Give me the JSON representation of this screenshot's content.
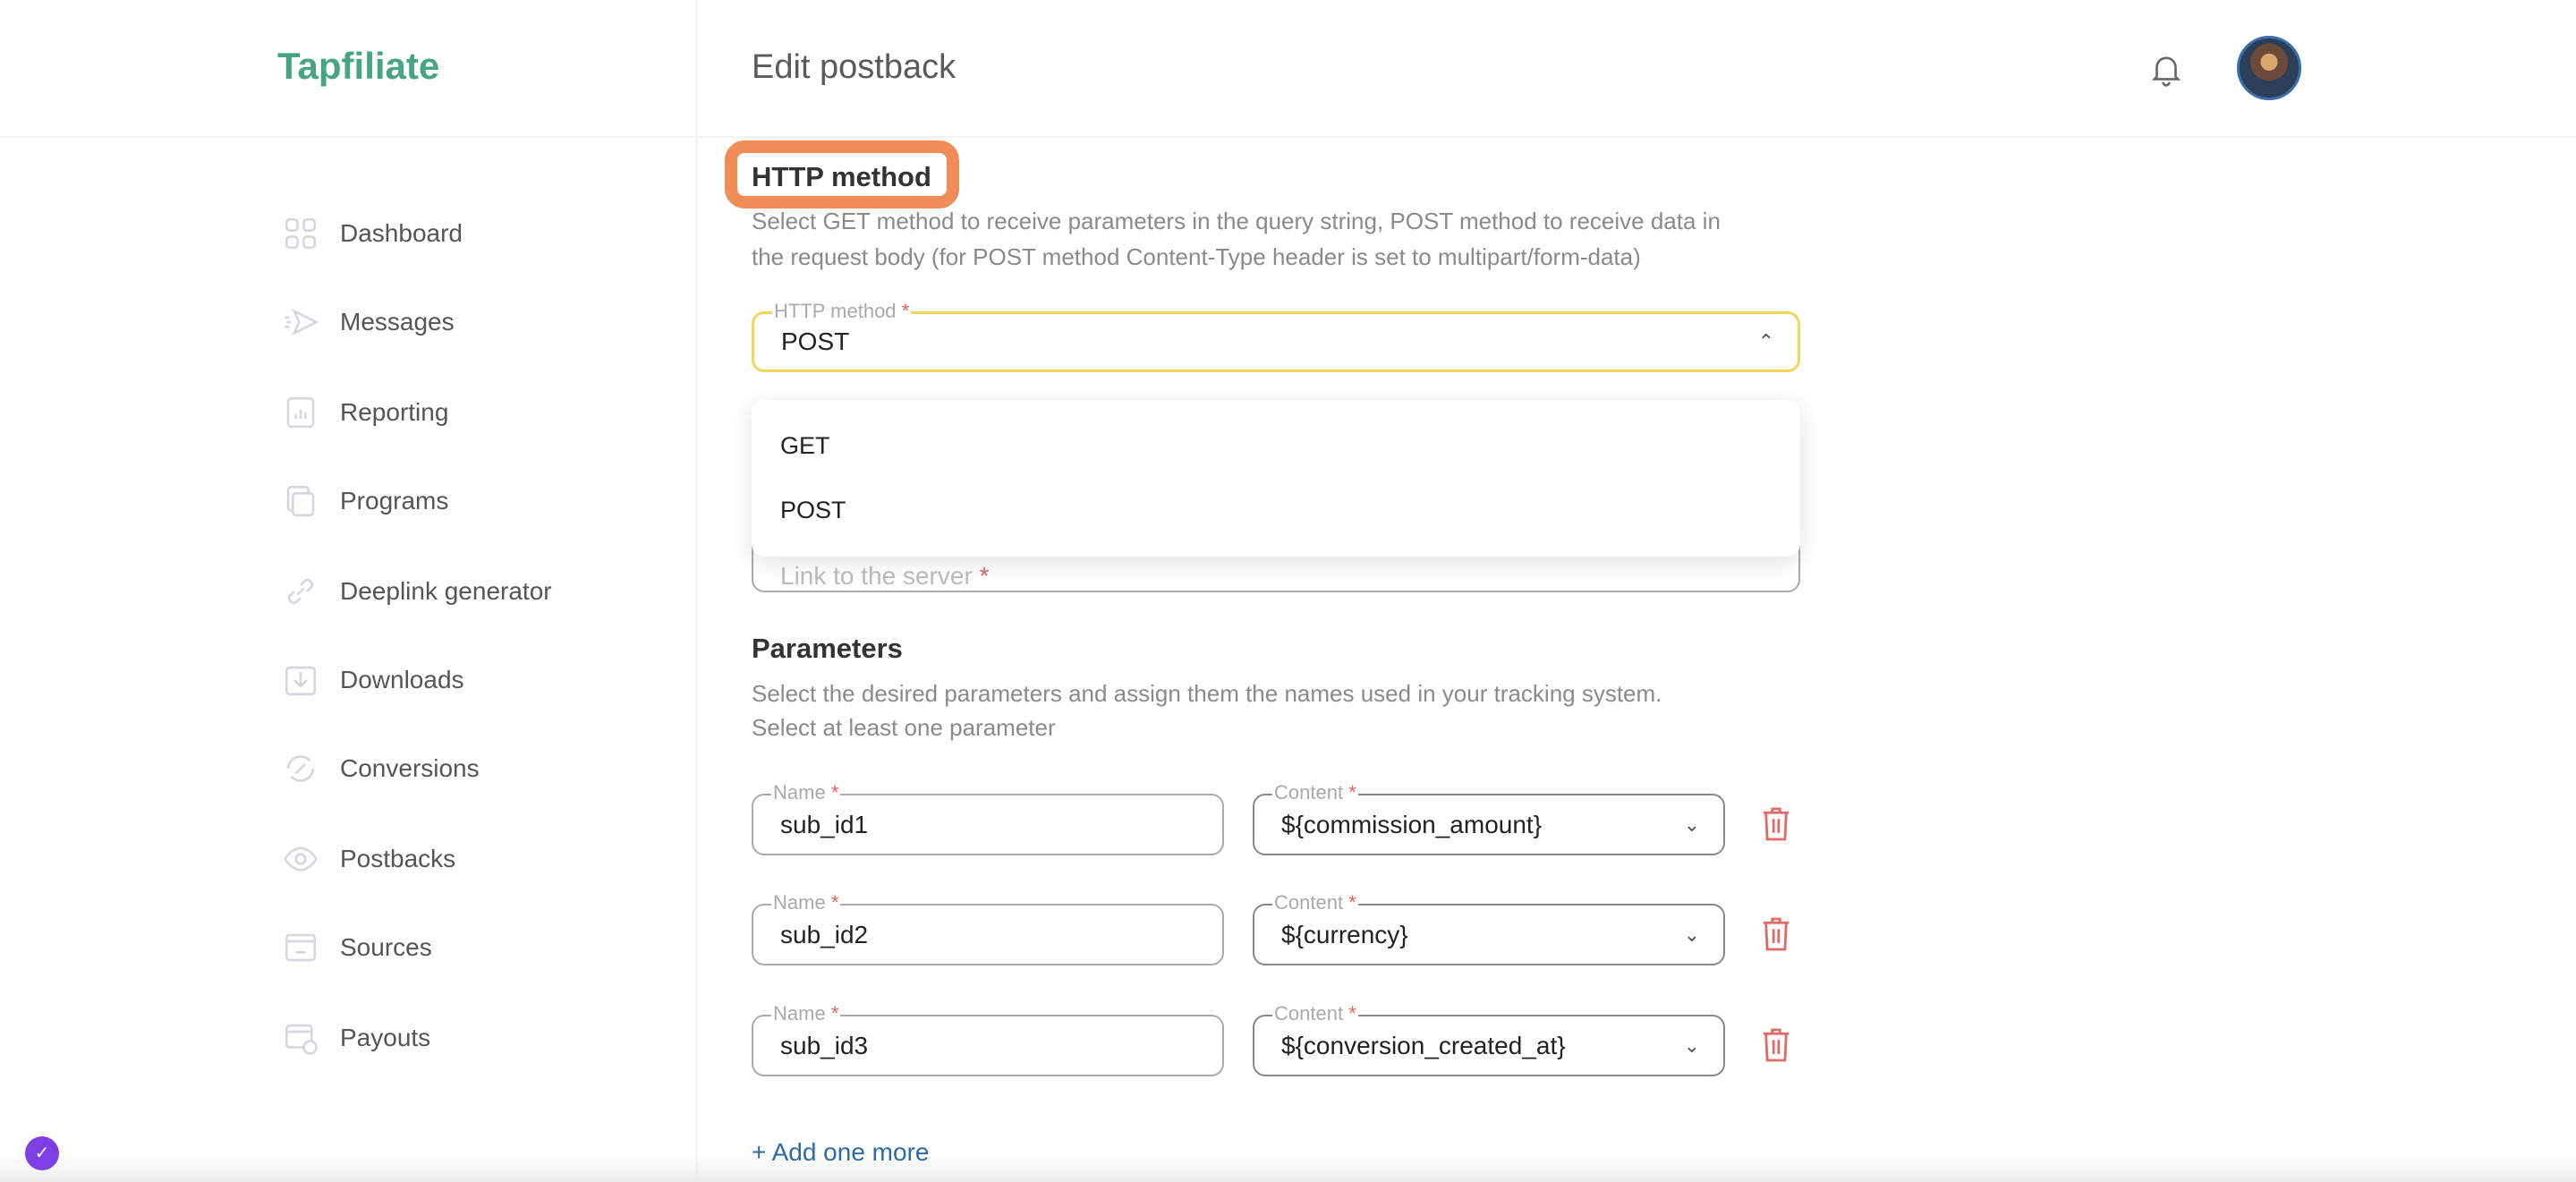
{
  "app": {
    "logo": "Tapfiliate",
    "page_title": "Edit postback"
  },
  "sidebar": {
    "items": [
      {
        "label": "Dashboard",
        "icon": "grid-icon"
      },
      {
        "label": "Messages",
        "icon": "send-icon"
      },
      {
        "label": "Reporting",
        "icon": "report-icon"
      },
      {
        "label": "Programs",
        "icon": "copy-icon"
      },
      {
        "label": "Deeplink generator",
        "icon": "link-icon"
      },
      {
        "label": "Downloads",
        "icon": "download-icon"
      },
      {
        "label": "Conversions",
        "icon": "conversion-icon"
      },
      {
        "label": "Postbacks",
        "icon": "eye-icon"
      },
      {
        "label": "Sources",
        "icon": "sources-icon"
      },
      {
        "label": "Payouts",
        "icon": "payouts-icon"
      }
    ]
  },
  "http_method": {
    "heading": "HTTP method",
    "description_1": "Select GET method to receive parameters in the query string, POST method to receive data in",
    "description_2": "the request body (for POST method Content-Type header is set to multipart/form-data)",
    "field_label": "HTTP method",
    "required": "*",
    "value": "POST",
    "options": [
      "GET",
      "POST"
    ],
    "highlight_color": "#f08c55",
    "focus_color": "#f2d65c"
  },
  "link": {
    "placeholder": "Link to the server",
    "required": "*"
  },
  "parameters": {
    "heading": "Parameters",
    "description_1": "Select the desired parameters and assign them the names used in your tracking system.",
    "description_2": "Select at least one parameter",
    "name_label": "Name",
    "content_label": "Content",
    "required": "*",
    "rows": [
      {
        "name": "sub_id1",
        "content": "${commission_amount}"
      },
      {
        "name": "sub_id2",
        "content": "${currency}"
      },
      {
        "name": "sub_id3",
        "content": "${conversion_created_at}"
      }
    ],
    "add_more": "+ Add one more"
  },
  "colors": {
    "brand": "#47a584",
    "link": "#2e6aa6",
    "delete": "#e06060"
  }
}
